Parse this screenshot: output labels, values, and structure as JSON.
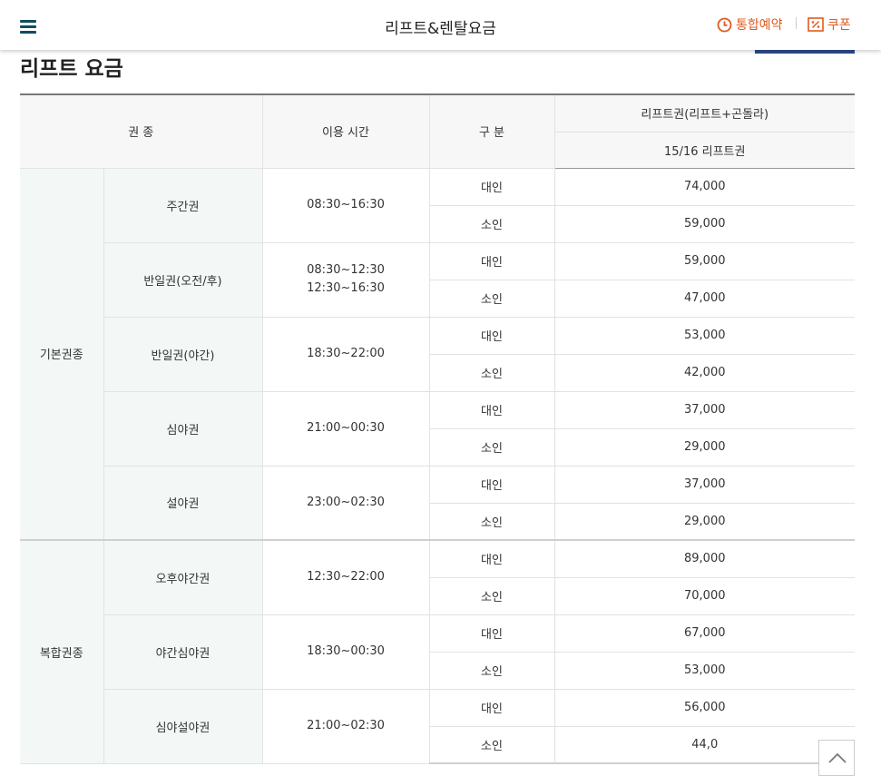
{
  "header": {
    "title": "리프트&렌탈요금",
    "reservation_label": "통합예약",
    "coupon_label": "쿠폰",
    "accent_color": "#e05a1e",
    "menu_icon": "hamburger-icon",
    "reservation_icon": "clock-icon",
    "coupon_icon": "percent-coupon-icon"
  },
  "page_title": "리프트 요금",
  "table": {
    "headers": {
      "type": "권 종",
      "time": "이용 시간",
      "division": "구 분",
      "lift_group": "리프트권(리프트+곤돌라)",
      "season": "15/16 리프트권"
    },
    "groups": [
      {
        "category": "기본권종",
        "tickets": [
          {
            "name": "주간권",
            "times": [
              "08:30~16:30"
            ],
            "rows": [
              {
                "div": "대인",
                "price": "74,000"
              },
              {
                "div": "소인",
                "price": "59,000"
              }
            ]
          },
          {
            "name": "반일권(오전/후)",
            "times": [
              "08:30~12:30",
              "12:30~16:30"
            ],
            "rows": [
              {
                "div": "대인",
                "price": "59,000"
              },
              {
                "div": "소인",
                "price": "47,000"
              }
            ]
          },
          {
            "name": "반일권(야간)",
            "times": [
              "18:30~22:00"
            ],
            "rows": [
              {
                "div": "대인",
                "price": "53,000"
              },
              {
                "div": "소인",
                "price": "42,000"
              }
            ]
          },
          {
            "name": "심야권",
            "times": [
              "21:00~00:30"
            ],
            "rows": [
              {
                "div": "대인",
                "price": "37,000"
              },
              {
                "div": "소인",
                "price": "29,000"
              }
            ]
          },
          {
            "name": "설야권",
            "times": [
              "23:00~02:30"
            ],
            "rows": [
              {
                "div": "대인",
                "price": "37,000"
              },
              {
                "div": "소인",
                "price": "29,000"
              }
            ]
          }
        ]
      },
      {
        "category": "복합권종",
        "tickets": [
          {
            "name": "오후야간권",
            "times": [
              "12:30~22:00"
            ],
            "rows": [
              {
                "div": "대인",
                "price": "89,000"
              },
              {
                "div": "소인",
                "price": "70,000"
              }
            ]
          },
          {
            "name": "야간심야권",
            "times": [
              "18:30~00:30"
            ],
            "rows": [
              {
                "div": "대인",
                "price": "67,000"
              },
              {
                "div": "소인",
                "price": "53,000"
              }
            ]
          },
          {
            "name": "심야설야권",
            "times": [
              "21:00~02:30"
            ],
            "rows": [
              {
                "div": "대인",
                "price": "56,000"
              },
              {
                "div": "소인",
                "price": "44,0"
              }
            ]
          }
        ]
      }
    ]
  },
  "scroll_top_icon": "chevron-up-icon"
}
